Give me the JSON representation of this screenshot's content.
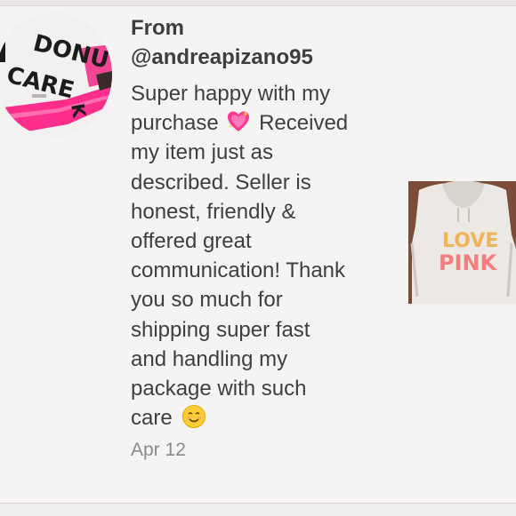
{
  "review": {
    "from_label": "From",
    "handle": "@andreapizano95",
    "message_lines": [
      "Super happy with my",
      "purchase",
      "Received",
      "my item just as",
      "described. Seller is",
      "honest, friendly &",
      "offered great",
      "communication! Thank",
      "you so much for",
      "shipping super fast",
      "and handling my",
      "package with such",
      "care"
    ],
    "date": "Apr 12"
  },
  "avatar": {
    "icon": "avatar-shirt-photo",
    "print_text": [
      "DONUT",
      "CARE",
      "K"
    ]
  },
  "product_image": {
    "icon": "product-hoodie-photo",
    "print_text": [
      "LOVE",
      "PINK"
    ]
  },
  "emojis": {
    "heart": "sparkling-heart-icon",
    "smile": "smiling-face-icon"
  },
  "colors": {
    "background": "#f6f3f3",
    "text": "#3f3f3f",
    "date": "#8a8a8a",
    "accent_pink": "#ff2d8b"
  }
}
